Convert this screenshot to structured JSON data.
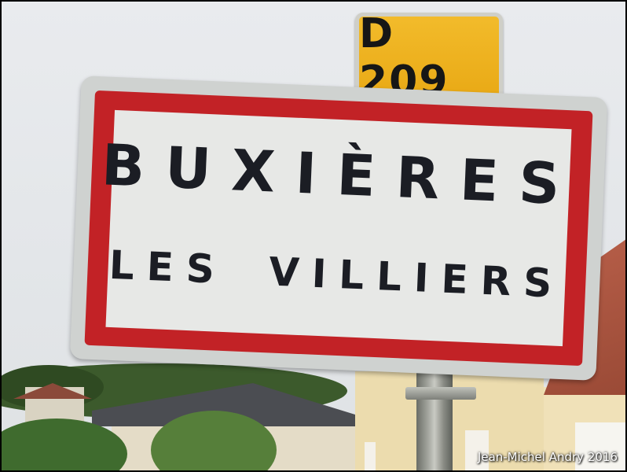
{
  "image": {
    "route_sign": {
      "text": "D 209",
      "color": "#f0b526"
    },
    "town_sign": {
      "line1": "BUXIÈRES",
      "line2": "LES VILLIERS",
      "border_color": "#c22226",
      "background_color": "#e7e8e6"
    },
    "photo_credit": "Jean-Michel Andry 2016"
  }
}
